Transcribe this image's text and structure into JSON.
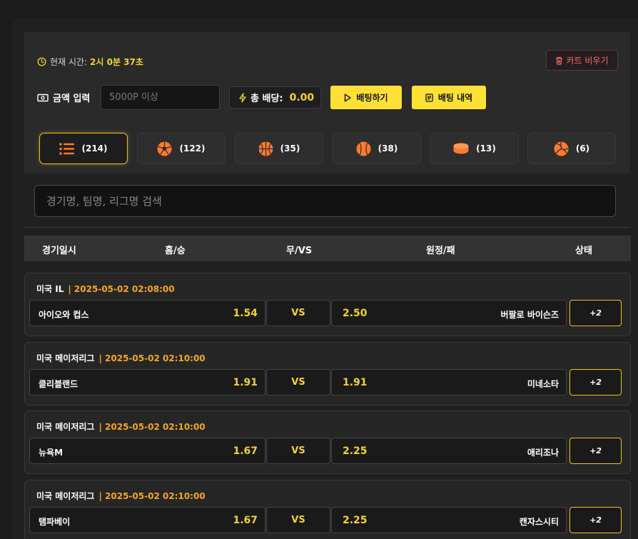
{
  "header": {
    "time_label": "현재 시간:",
    "time_value": "2시 0분 37초",
    "clear_cart": "카트 비우기"
  },
  "bet": {
    "amount_label": "금액 입력",
    "amount_placeholder": "5000P 이상",
    "total_label": "총 배당:",
    "total_value": "0.00",
    "place_bet": "배팅하기",
    "history": "배팅 내역"
  },
  "tabs": [
    {
      "icon": "list-icon",
      "count": "(214)"
    },
    {
      "icon": "soccer-ball-icon",
      "count": "(122)"
    },
    {
      "icon": "basketball-icon",
      "count": "(35)"
    },
    {
      "icon": "baseball-icon",
      "count": "(38)"
    },
    {
      "icon": "hockey-puck-icon",
      "count": "(13)"
    },
    {
      "icon": "volleyball-icon",
      "count": "(6)"
    }
  ],
  "search": {
    "placeholder": "경기명, 팀명, 리그명 검색"
  },
  "columns": [
    "경기일시",
    "홈/승",
    "무/VS",
    "원정/패",
    "상태"
  ],
  "matches": [
    {
      "league": "미국 IL",
      "date": "| 2025-05-02 02:08:00",
      "home": "아이오와 컵스",
      "home_odds": "1.54",
      "vs": "VS",
      "away_odds": "2.50",
      "away": "버팔로 바이슨즈",
      "more": "+2"
    },
    {
      "league": "미국 메이저리그",
      "date": "| 2025-05-02 02:10:00",
      "home": "클리블랜드",
      "home_odds": "1.91",
      "vs": "VS",
      "away_odds": "1.91",
      "away": "미네소타",
      "more": "+2"
    },
    {
      "league": "미국 메이저리그",
      "date": "| 2025-05-02 02:10:00",
      "home": "뉴욕M",
      "home_odds": "1.67",
      "vs": "VS",
      "away_odds": "2.25",
      "away": "애리조나",
      "more": "+2"
    },
    {
      "league": "미국 메이저리그",
      "date": "| 2025-05-02 02:10:00",
      "home": "탬파베이",
      "home_odds": "1.67",
      "vs": "VS",
      "away_odds": "2.25",
      "away": "캔자스시티",
      "more": "+2"
    }
  ],
  "colors": {
    "accent_yellow": "#ffe135",
    "odds_yellow": "#f5d232",
    "date_orange": "#f5a623",
    "icon_orange": "#ff7a2f",
    "danger_red": "#ff6a6a"
  }
}
